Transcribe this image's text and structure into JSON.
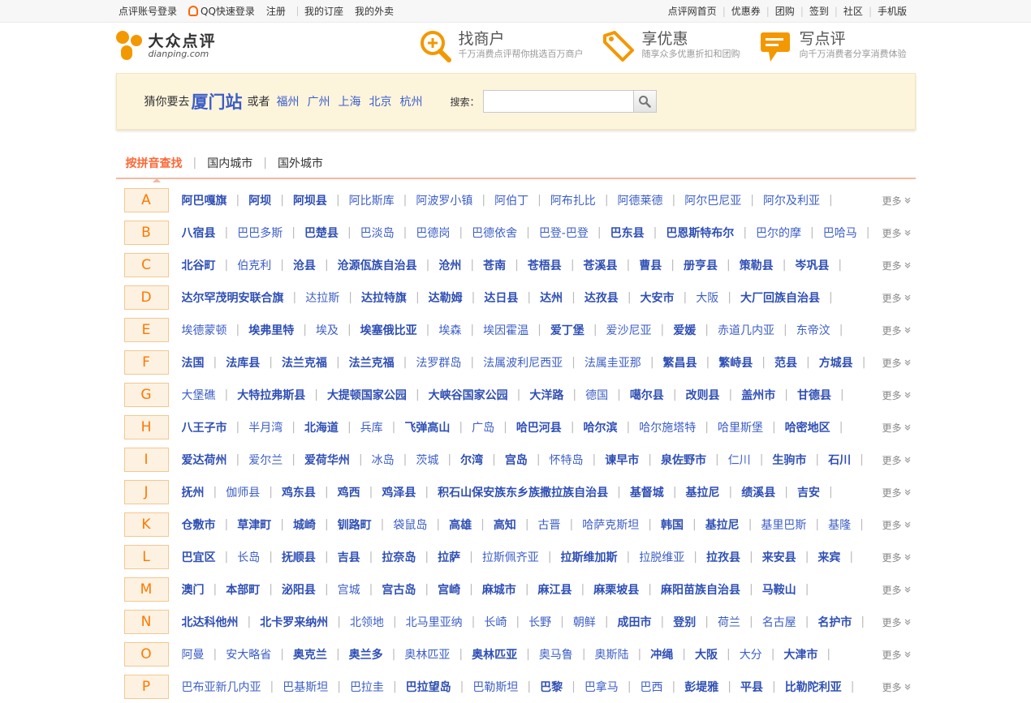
{
  "topbar": {
    "left": [
      "点评账号登录",
      "QQ快速登录",
      "注册",
      "我的订座",
      "我的外卖"
    ],
    "right": [
      "点评网首页",
      "优惠券",
      "团购",
      "签到",
      "社区",
      "手机版"
    ]
  },
  "logo": {
    "cn": "大众点评",
    "en": "dianping.com"
  },
  "features": [
    {
      "title": "找商户",
      "sub": "千万消费点评帮你挑选百万商户",
      "icon": "magnifier-plus-icon"
    },
    {
      "title": "享优惠",
      "sub": "随享众多优惠折扣和团购",
      "icon": "tag-icon"
    },
    {
      "title": "写点评",
      "sub": "向千万消费者分享消费体验",
      "icon": "speech-bubble-icon"
    }
  ],
  "guess": {
    "prefix": "猜你要去",
    "city": "厦门站",
    "or": "或者",
    "cities": [
      "福州",
      "广州",
      "上海",
      "北京",
      "杭州"
    ]
  },
  "search": {
    "label": "搜索：",
    "placeholder": ""
  },
  "tabs": [
    "按拼音查找",
    "国内城市",
    "国外城市"
  ],
  "more_label": "更多",
  "rows": [
    {
      "letter": "A",
      "cities": [
        {
          "n": "阿巴嘎旗",
          "b": 1
        },
        {
          "n": "阿坝",
          "b": 1
        },
        {
          "n": "阿坝县",
          "b": 1
        },
        {
          "n": "阿比斯库"
        },
        {
          "n": "阿波罗小镇"
        },
        {
          "n": "阿伯丁"
        },
        {
          "n": "阿布扎比"
        },
        {
          "n": "阿德莱德"
        },
        {
          "n": "阿尔巴尼亚"
        },
        {
          "n": "阿尔及利亚"
        }
      ]
    },
    {
      "letter": "B",
      "cities": [
        {
          "n": "八宿县",
          "b": 1
        },
        {
          "n": "巴巴多斯"
        },
        {
          "n": "巴楚县",
          "b": 1
        },
        {
          "n": "巴淡岛"
        },
        {
          "n": "巴德岗"
        },
        {
          "n": "巴德依舍"
        },
        {
          "n": "巴登-巴登"
        },
        {
          "n": "巴东县",
          "b": 1
        },
        {
          "n": "巴恩斯特布尔",
          "b": 1
        },
        {
          "n": "巴尔的摩"
        },
        {
          "n": "巴哈马"
        }
      ]
    },
    {
      "letter": "C",
      "cities": [
        {
          "n": "北谷町",
          "b": 1
        },
        {
          "n": "伯克利"
        },
        {
          "n": "沧县",
          "b": 1
        },
        {
          "n": "沧源佤族自治县",
          "b": 1
        },
        {
          "n": "沧州",
          "b": 1
        },
        {
          "n": "苍南",
          "b": 1
        },
        {
          "n": "苍梧县",
          "b": 1
        },
        {
          "n": "苍溪县",
          "b": 1
        },
        {
          "n": "曹县",
          "b": 1
        },
        {
          "n": "册亨县",
          "b": 1
        },
        {
          "n": "策勒县",
          "b": 1
        },
        {
          "n": "岑巩县",
          "b": 1
        }
      ]
    },
    {
      "letter": "D",
      "cities": [
        {
          "n": "达尔罕茂明安联合旗",
          "b": 1
        },
        {
          "n": "达拉斯"
        },
        {
          "n": "达拉特旗",
          "b": 1
        },
        {
          "n": "达勒姆",
          "b": 1
        },
        {
          "n": "达日县",
          "b": 1
        },
        {
          "n": "达州",
          "b": 1
        },
        {
          "n": "达孜县",
          "b": 1
        },
        {
          "n": "大安市",
          "b": 1
        },
        {
          "n": "大阪"
        },
        {
          "n": "大厂回族自治县",
          "b": 1
        }
      ]
    },
    {
      "letter": "E",
      "cities": [
        {
          "n": "埃德蒙顿"
        },
        {
          "n": "埃弗里特",
          "b": 1
        },
        {
          "n": "埃及"
        },
        {
          "n": "埃塞俄比亚",
          "b": 1
        },
        {
          "n": "埃森"
        },
        {
          "n": "埃因霍温"
        },
        {
          "n": "爱丁堡",
          "b": 1
        },
        {
          "n": "爱沙尼亚"
        },
        {
          "n": "爱媛",
          "b": 1
        },
        {
          "n": "赤道几内亚"
        },
        {
          "n": "东帝汶"
        }
      ]
    },
    {
      "letter": "F",
      "cities": [
        {
          "n": "法国",
          "b": 1
        },
        {
          "n": "法库县",
          "b": 1
        },
        {
          "n": "法兰克福",
          "b": 1
        },
        {
          "n": "法兰克福",
          "b": 1
        },
        {
          "n": "法罗群岛"
        },
        {
          "n": "法属波利尼西亚"
        },
        {
          "n": "法属圭亚那"
        },
        {
          "n": "繁昌县",
          "b": 1
        },
        {
          "n": "繁峙县",
          "b": 1
        },
        {
          "n": "范县",
          "b": 1
        },
        {
          "n": "方城县",
          "b": 1
        }
      ]
    },
    {
      "letter": "G",
      "cities": [
        {
          "n": "大堡礁"
        },
        {
          "n": "大特拉弗斯县",
          "b": 1
        },
        {
          "n": "大提顿国家公园",
          "b": 1
        },
        {
          "n": "大峡谷国家公园",
          "b": 1
        },
        {
          "n": "大洋路",
          "b": 1
        },
        {
          "n": "德国"
        },
        {
          "n": "噶尔县",
          "b": 1
        },
        {
          "n": "改则县",
          "b": 1
        },
        {
          "n": "盖州市",
          "b": 1
        },
        {
          "n": "甘德县",
          "b": 1
        }
      ]
    },
    {
      "letter": "H",
      "cities": [
        {
          "n": "八王子市",
          "b": 1
        },
        {
          "n": "半月湾"
        },
        {
          "n": "北海道",
          "b": 1
        },
        {
          "n": "兵库"
        },
        {
          "n": "飞弹高山",
          "b": 1
        },
        {
          "n": "广岛"
        },
        {
          "n": "哈巴河县",
          "b": 1
        },
        {
          "n": "哈尔滨",
          "b": 1
        },
        {
          "n": "哈尔施塔特"
        },
        {
          "n": "哈里斯堡"
        },
        {
          "n": "哈密地区",
          "b": 1
        }
      ]
    },
    {
      "letter": "I",
      "cities": [
        {
          "n": "爱达荷州",
          "b": 1
        },
        {
          "n": "爱尔兰"
        },
        {
          "n": "爱荷华州",
          "b": 1
        },
        {
          "n": "冰岛"
        },
        {
          "n": "茨城"
        },
        {
          "n": "尔湾",
          "b": 1
        },
        {
          "n": "宫岛",
          "b": 1
        },
        {
          "n": "怀特岛"
        },
        {
          "n": "谏早市",
          "b": 1
        },
        {
          "n": "泉佐野市",
          "b": 1
        },
        {
          "n": "仁川"
        },
        {
          "n": "生驹市",
          "b": 1
        },
        {
          "n": "石川",
          "b": 1
        }
      ]
    },
    {
      "letter": "J",
      "cities": [
        {
          "n": "抚州",
          "b": 1
        },
        {
          "n": "伽师县"
        },
        {
          "n": "鸡东县",
          "b": 1
        },
        {
          "n": "鸡西",
          "b": 1
        },
        {
          "n": "鸡泽县",
          "b": 1
        },
        {
          "n": "积石山保安族东乡族撒拉族自治县",
          "b": 1
        },
        {
          "n": "基督城",
          "b": 1
        },
        {
          "n": "基拉尼",
          "b": 1
        },
        {
          "n": "绩溪县",
          "b": 1
        },
        {
          "n": "吉安",
          "b": 1
        }
      ]
    },
    {
      "letter": "K",
      "cities": [
        {
          "n": "仓敷市",
          "b": 1
        },
        {
          "n": "草津町",
          "b": 1
        },
        {
          "n": "城崎",
          "b": 1
        },
        {
          "n": "钏路町",
          "b": 1
        },
        {
          "n": "袋鼠岛"
        },
        {
          "n": "高雄",
          "b": 1
        },
        {
          "n": "高知",
          "b": 1
        },
        {
          "n": "古晋"
        },
        {
          "n": "哈萨克斯坦"
        },
        {
          "n": "韩国",
          "b": 1
        },
        {
          "n": "基拉尼",
          "b": 1
        },
        {
          "n": "基里巴斯"
        },
        {
          "n": "基隆"
        }
      ]
    },
    {
      "letter": "L",
      "cities": [
        {
          "n": "巴宜区",
          "b": 1
        },
        {
          "n": "长岛"
        },
        {
          "n": "抚顺县",
          "b": 1
        },
        {
          "n": "吉县",
          "b": 1
        },
        {
          "n": "拉奈岛",
          "b": 1
        },
        {
          "n": "拉萨",
          "b": 1
        },
        {
          "n": "拉斯佩齐亚"
        },
        {
          "n": "拉斯维加斯",
          "b": 1
        },
        {
          "n": "拉脱维亚"
        },
        {
          "n": "拉孜县",
          "b": 1
        },
        {
          "n": "来安县",
          "b": 1
        },
        {
          "n": "来宾",
          "b": 1
        }
      ]
    },
    {
      "letter": "M",
      "cities": [
        {
          "n": "澳门",
          "b": 1
        },
        {
          "n": "本部町",
          "b": 1
        },
        {
          "n": "泌阳县",
          "b": 1
        },
        {
          "n": "宫城"
        },
        {
          "n": "宫古岛",
          "b": 1
        },
        {
          "n": "宫崎",
          "b": 1
        },
        {
          "n": "麻城市",
          "b": 1
        },
        {
          "n": "麻江县",
          "b": 1
        },
        {
          "n": "麻栗坡县",
          "b": 1
        },
        {
          "n": "麻阳苗族自治县",
          "b": 1
        },
        {
          "n": "马鞍山",
          "b": 1
        }
      ]
    },
    {
      "letter": "N",
      "cities": [
        {
          "n": "北达科他州",
          "b": 1
        },
        {
          "n": "北卡罗来纳州",
          "b": 1
        },
        {
          "n": "北领地"
        },
        {
          "n": "北马里亚纳"
        },
        {
          "n": "长崎"
        },
        {
          "n": "长野"
        },
        {
          "n": "朝鲜"
        },
        {
          "n": "成田市",
          "b": 1
        },
        {
          "n": "登别",
          "b": 1
        },
        {
          "n": "荷兰"
        },
        {
          "n": "名古屋"
        },
        {
          "n": "名护市",
          "b": 1
        }
      ]
    },
    {
      "letter": "O",
      "cities": [
        {
          "n": "阿曼"
        },
        {
          "n": "安大略省"
        },
        {
          "n": "奥克兰",
          "b": 1
        },
        {
          "n": "奥兰多",
          "b": 1
        },
        {
          "n": "奥林匹亚"
        },
        {
          "n": "奥林匹亚",
          "b": 1
        },
        {
          "n": "奥马鲁"
        },
        {
          "n": "奥斯陆"
        },
        {
          "n": "冲绳",
          "b": 1
        },
        {
          "n": "大阪",
          "b": 1
        },
        {
          "n": "大分"
        },
        {
          "n": "大津市",
          "b": 1
        }
      ]
    },
    {
      "letter": "P",
      "cities": [
        {
          "n": "巴布亚新几内亚"
        },
        {
          "n": "巴基斯坦"
        },
        {
          "n": "巴拉圭"
        },
        {
          "n": "巴拉望岛",
          "b": 1
        },
        {
          "n": "巴勒斯坦"
        },
        {
          "n": "巴黎",
          "b": 1
        },
        {
          "n": "巴拿马"
        },
        {
          "n": "巴西"
        },
        {
          "n": "彭堤雅",
          "b": 1
        },
        {
          "n": "平县",
          "b": 1
        },
        {
          "n": "比勒陀利亚",
          "b": 1
        }
      ]
    }
  ]
}
